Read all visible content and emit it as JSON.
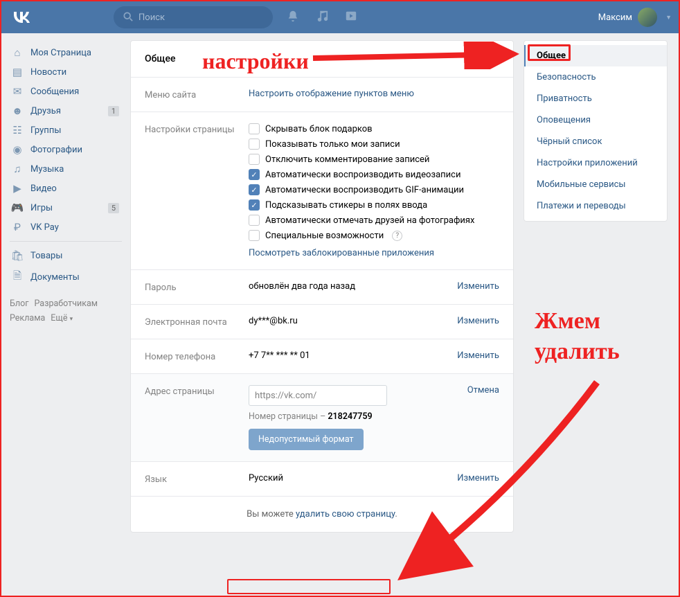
{
  "header": {
    "search_placeholder": "Поиск",
    "username": "Максим"
  },
  "sidebar": {
    "items": [
      {
        "label": "Моя Страница",
        "icon": "home"
      },
      {
        "label": "Новости",
        "icon": "news"
      },
      {
        "label": "Сообщения",
        "icon": "msg"
      },
      {
        "label": "Друзья",
        "icon": "friends",
        "count": "1"
      },
      {
        "label": "Группы",
        "icon": "groups"
      },
      {
        "label": "Фотографии",
        "icon": "photos"
      },
      {
        "label": "Музыка",
        "icon": "music"
      },
      {
        "label": "Видео",
        "icon": "video"
      },
      {
        "label": "Игры",
        "icon": "games",
        "count": "5"
      },
      {
        "label": "VK Pay",
        "icon": "pay"
      }
    ],
    "items2": [
      {
        "label": "Товары",
        "icon": "market"
      },
      {
        "label": "Документы",
        "icon": "docs"
      }
    ],
    "footer": {
      "l1a": "Блог",
      "l1b": "Разработчикам",
      "l2a": "Реклама",
      "l2b": "Ещё"
    }
  },
  "settings": {
    "title": "Общее",
    "menu_row": {
      "label": "Меню сайта",
      "link": "Настроить отображение пунктов меню"
    },
    "page_row": {
      "label": "Настройки страницы",
      "opts": [
        {
          "label": "Скрывать блок подарков",
          "checked": false
        },
        {
          "label": "Показывать только мои записи",
          "checked": false
        },
        {
          "label": "Отключить комментирование записей",
          "checked": false
        },
        {
          "label": "Автоматически воспроизводить видеозаписи",
          "checked": true
        },
        {
          "label": "Автоматически воспроизводить GIF-анимации",
          "checked": true
        },
        {
          "label": "Подсказывать стикеры в полях ввода",
          "checked": true
        },
        {
          "label": "Автоматически отмечать друзей на фотографиях",
          "checked": false
        },
        {
          "label": "Специальные возможности",
          "checked": false,
          "help": true
        }
      ],
      "blocked_link": "Посмотреть заблокированные приложения"
    },
    "password": {
      "label": "Пароль",
      "value": "обновлён два года назад",
      "action": "Изменить"
    },
    "email": {
      "label": "Электронная почта",
      "value": "dy***@bk.ru",
      "action": "Изменить"
    },
    "phone": {
      "label": "Номер телефона",
      "value": "+7 7** *** ** 01",
      "action": "Изменить"
    },
    "address": {
      "label": "Адрес страницы",
      "input": "https://vk.com/",
      "action": "Отмена",
      "page_num_prefix": "Номер страницы – ",
      "page_num": "218247759",
      "invalid_btn": "Недопустимый формат"
    },
    "lang": {
      "label": "Язык",
      "value": "Русский",
      "action": "Изменить"
    },
    "delete": {
      "prefix": "Вы можете ",
      "link": "удалить свою страницу",
      "suffix": "."
    }
  },
  "right_nav": [
    "Общее",
    "Безопасность",
    "Приватность",
    "Оповещения",
    "Чёрный список",
    "Настройки приложений",
    "Мобильные сервисы",
    "Платежи и переводы"
  ],
  "annotations": {
    "a1": "настройки",
    "a2": "Жмем\nудалить"
  }
}
